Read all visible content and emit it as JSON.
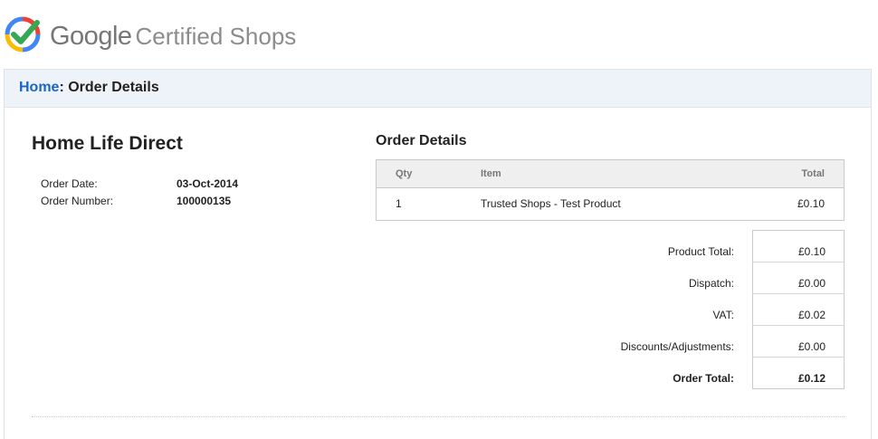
{
  "header": {
    "brand": "Google",
    "product": "Certified Shops"
  },
  "breadcrumb": {
    "home": "Home",
    "separator": ": ",
    "current": "Order Details"
  },
  "shop": {
    "name": "Home Life Direct",
    "order_date_label": "Order Date:",
    "order_date": "03-Oct-2014",
    "order_number_label": "Order Number:",
    "order_number": "100000135"
  },
  "order_details": {
    "title": "Order Details",
    "columns": {
      "qty": "Qty",
      "item": "Item",
      "total": "Total"
    },
    "rows": [
      {
        "qty": "1",
        "item": "Trusted Shops - Test Product",
        "total": "£0.10"
      }
    ]
  },
  "totals": {
    "product_total_label": "Product Total:",
    "product_total": "£0.10",
    "dispatch_label": "Dispatch:",
    "dispatch": "£0.00",
    "vat_label": "VAT:",
    "vat": "£0.02",
    "discounts_label": "Discounts/Adjustments:",
    "discounts": "£0.00",
    "order_total_label": "Order Total:",
    "order_total": "£0.12"
  },
  "colors": {
    "link": "#1a66c7",
    "crumb_bg": "#eef3fa",
    "logo_green": "#34a853",
    "logo_blue": "#4285f4",
    "logo_red": "#ea4335",
    "logo_yellow": "#fbbc05"
  },
  "icons": {
    "logo": "google-certified-check-icon"
  }
}
